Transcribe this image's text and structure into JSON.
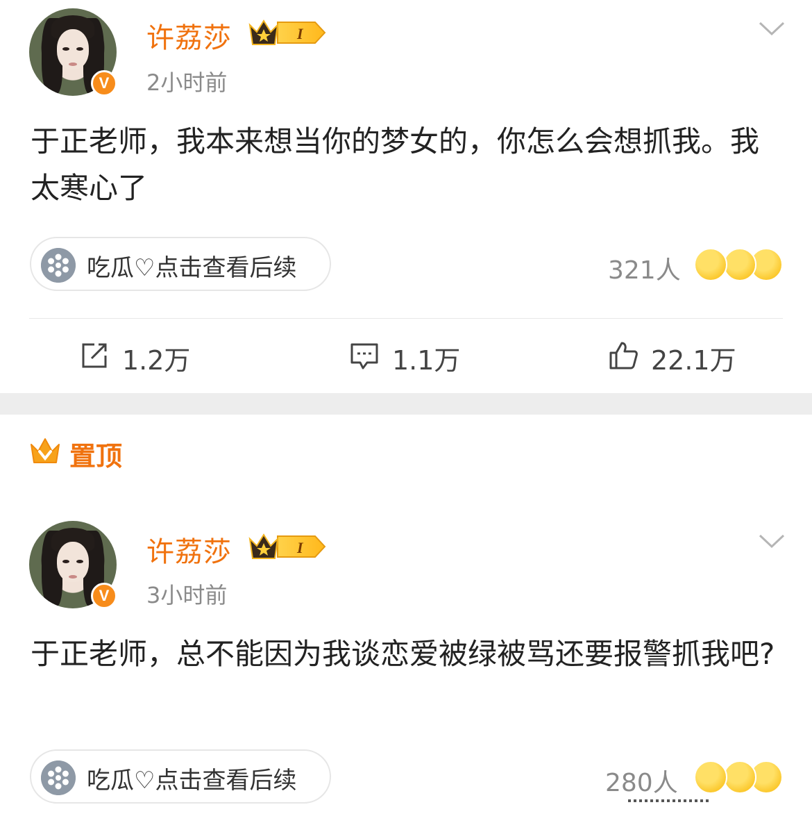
{
  "posts": [
    {
      "username": "许荔莎",
      "vip_level": "I",
      "verified_mark": "V",
      "time": "2小时前",
      "content": "于正老师，我本来想当你的梦女的，你怎么会想抓我。我太寒心了",
      "topic_pill": "吃瓜♡点击查看后续",
      "reaction_count": "321人",
      "reaction_emojis": [
        "laughing-emoji",
        "shocked-emoji",
        "laugh-cry-emoji"
      ],
      "actions": {
        "repost": "1.2万",
        "comment": "1.1万",
        "like": "22.1万"
      }
    },
    {
      "pinned_label": "置顶",
      "username": "许荔莎",
      "vip_level": "I",
      "verified_mark": "V",
      "time": "3小时前",
      "content": "于正老师，总不能因为我谈恋爱被绿被骂还要报警抓我吧?",
      "topic_pill": "吃瓜♡点击查看后续",
      "reaction_count": "280人",
      "reaction_emojis": [
        "laughing-emoji",
        "laugh-cry-emoji",
        "shocked-emoji"
      ]
    }
  ],
  "colors": {
    "username": "#f0720e",
    "verified_badge": "#f78c1b",
    "muted_text": "#8a8a8a",
    "separator": "#ededed"
  }
}
